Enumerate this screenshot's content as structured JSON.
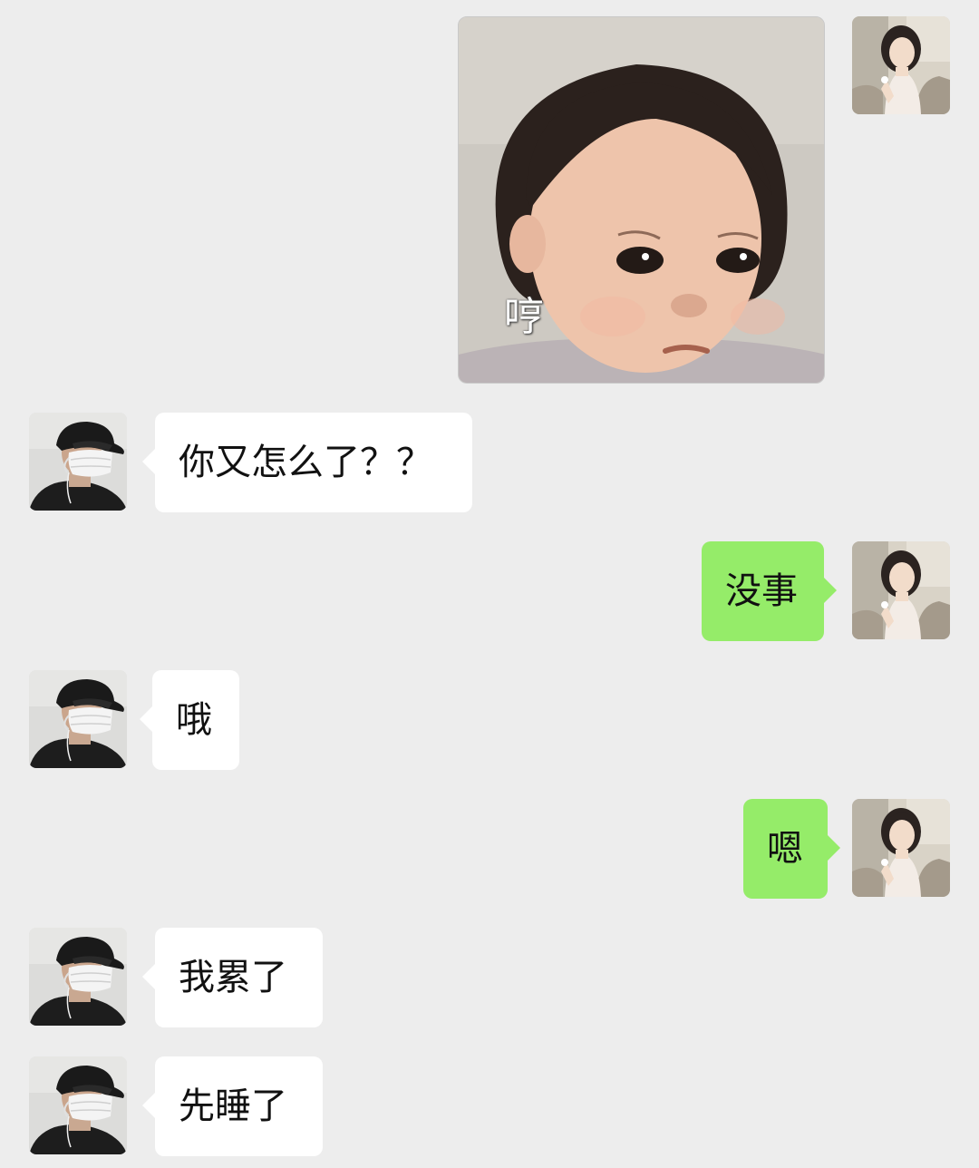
{
  "messages": [
    {
      "side": "me",
      "type": "sticker",
      "caption": "哼",
      "avatar_icon": "girl-avatar-icon"
    },
    {
      "side": "them",
      "type": "text",
      "text": "你又怎么了？？",
      "avatar_icon": "masked-man-avatar-icon"
    },
    {
      "side": "me",
      "type": "text",
      "text": "没事",
      "avatar_icon": "girl-avatar-icon"
    },
    {
      "side": "them",
      "type": "text",
      "text": "哦",
      "avatar_icon": "masked-man-avatar-icon"
    },
    {
      "side": "me",
      "type": "text",
      "text": "嗯",
      "avatar_icon": "girl-avatar-icon"
    },
    {
      "side": "them",
      "type": "text",
      "text": "我累了",
      "avatar_icon": "masked-man-avatar-icon"
    },
    {
      "side": "them",
      "type": "text",
      "text": "先睡了",
      "avatar_icon": "masked-man-avatar-icon"
    }
  ],
  "colors": {
    "background": "#ededed",
    "sent_bubble": "#95ec69",
    "received_bubble": "#ffffff"
  }
}
